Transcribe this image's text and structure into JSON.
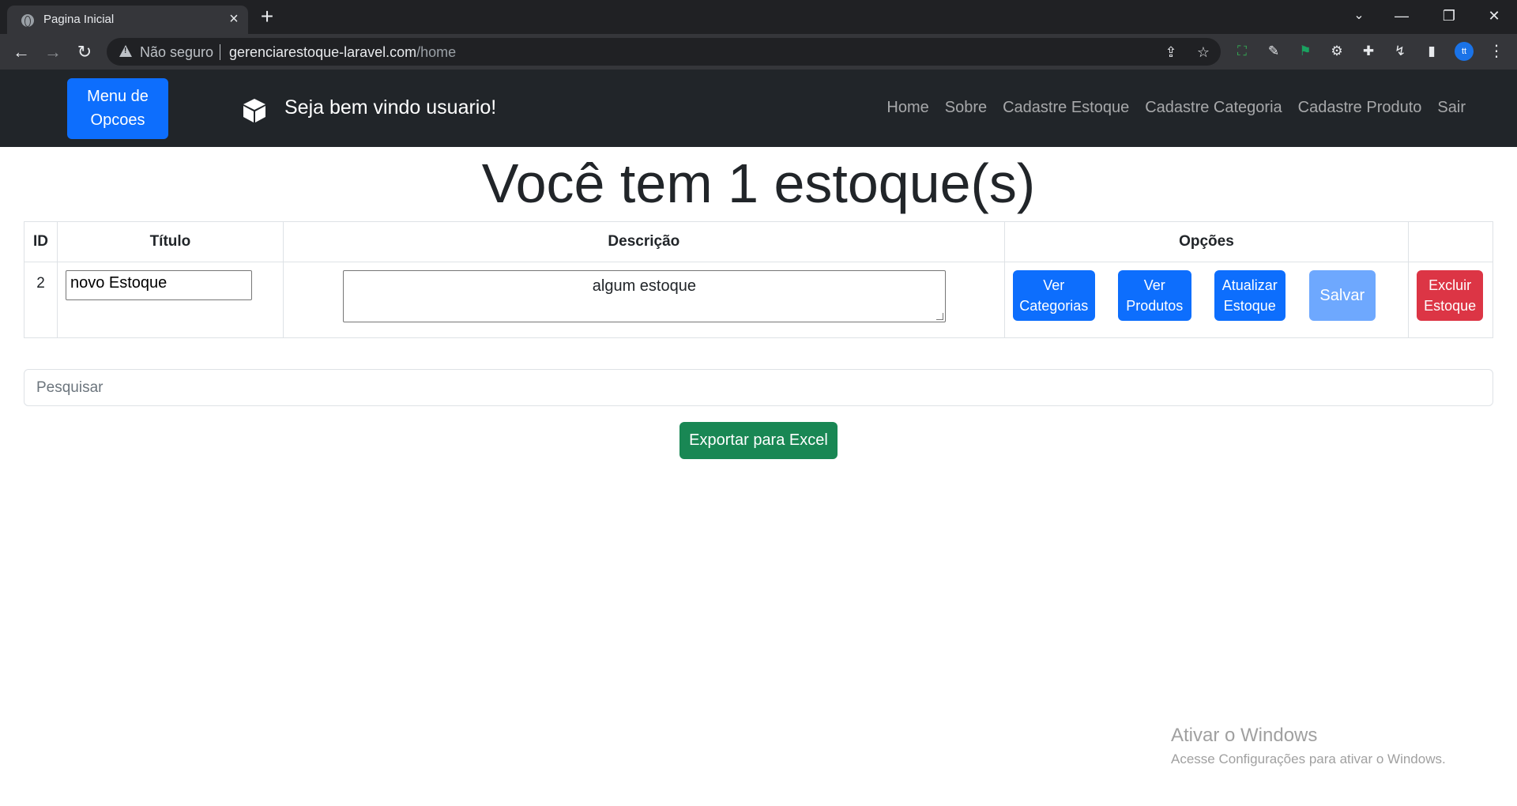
{
  "browser": {
    "tab_title": "Pagina Inicial",
    "security_label": "Não seguro",
    "url_host": "gerenciarestoque-laravel.com",
    "url_path": "/home",
    "profile_initials": "tt"
  },
  "navbar": {
    "menu_button": "Menu de Opcoes",
    "welcome": "Seja bem vindo usuario!",
    "links": [
      "Home",
      "Sobre",
      "Cadastre Estoque",
      "Cadastre Categoria",
      "Cadastre Produto",
      "Sair"
    ]
  },
  "page": {
    "heading": "Você tem 1 estoque(s)"
  },
  "table": {
    "headers": {
      "id": "ID",
      "title": "Título",
      "description": "Descrição",
      "options": "Opções"
    },
    "rows": [
      {
        "id": "2",
        "title": "novo Estoque",
        "description": "algum estoque",
        "buttons": {
          "categories": "Ver Categorias",
          "products": "Ver Produtos",
          "update": "Atualizar Estoque",
          "save": "Salvar",
          "delete": "Excluir Estoque"
        }
      }
    ]
  },
  "search": {
    "placeholder": "Pesquisar"
  },
  "export_button": "Exportar para Excel",
  "watermark": {
    "title": "Ativar o Windows",
    "subtitle": "Acesse Configurações para ativar o Windows."
  },
  "colors": {
    "primary": "#0d6efd",
    "primary_light": "#6ea8fe",
    "danger": "#dc3545",
    "success": "#198754",
    "navbar": "#212529"
  }
}
